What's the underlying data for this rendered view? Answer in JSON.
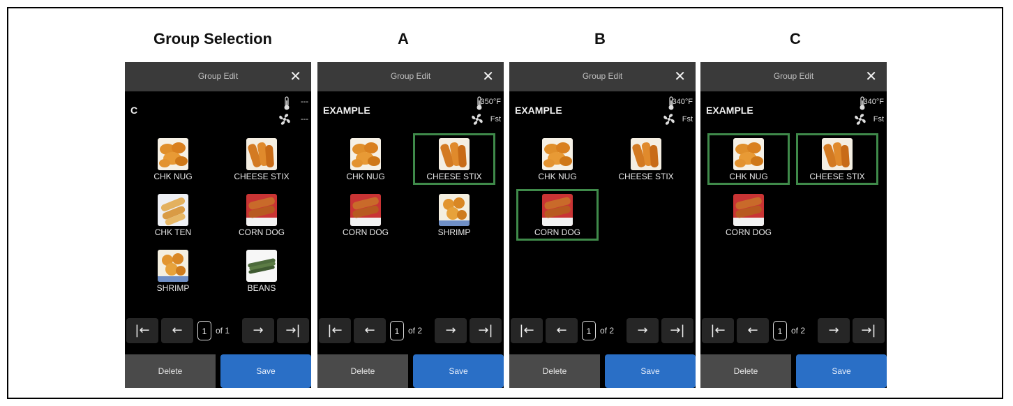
{
  "titles": {
    "group_selection": "Group Selection",
    "a": "A",
    "b": "B",
    "c": "C"
  },
  "screens": [
    {
      "header_title": "Group Edit",
      "close_glyph": "✕",
      "group_name": "C",
      "temp": "---",
      "fan": "---",
      "items": [
        {
          "label": "CHK NUG",
          "icon": "chicken-nuggets-image",
          "selected": false
        },
        {
          "label": "CHEESE STIX",
          "icon": "cheese-sticks-image",
          "selected": false
        },
        {
          "label": "CHK TEN",
          "icon": "chicken-tenders-image",
          "selected": false
        },
        {
          "label": "CORN DOG",
          "icon": "corn-dog-image",
          "selected": false
        },
        {
          "label": "SHRIMP",
          "icon": "shrimp-image",
          "selected": false
        },
        {
          "label": "BEANS",
          "icon": "beans-image",
          "selected": false
        }
      ],
      "pager": {
        "first": "|←",
        "prev": "←",
        "page": "1",
        "of": "of 1",
        "next": "→",
        "last": "→|"
      },
      "delete_label": "Delete",
      "save_label": "Save"
    },
    {
      "header_title": "Group Edit",
      "close_glyph": "✕",
      "group_name": "EXAMPLE",
      "temp": "350°F",
      "fan": "Fst",
      "items": [
        {
          "label": "CHK NUG",
          "icon": "chicken-nuggets-image",
          "selected": false
        },
        {
          "label": "CHEESE STIX",
          "icon": "cheese-sticks-image",
          "selected": true
        },
        {
          "label": "CORN DOG",
          "icon": "corn-dog-image",
          "selected": false
        },
        {
          "label": "SHRIMP",
          "icon": "shrimp-image",
          "selected": false
        }
      ],
      "pager": {
        "first": "|←",
        "prev": "←",
        "page": "1",
        "of": "of 2",
        "next": "→",
        "last": "→|"
      },
      "delete_label": "Delete",
      "save_label": "Save"
    },
    {
      "header_title": "Group Edit",
      "close_glyph": "✕",
      "group_name": "EXAMPLE",
      "temp": "340°F",
      "fan": "Fst",
      "items": [
        {
          "label": "CHK NUG",
          "icon": "chicken-nuggets-image",
          "selected": false
        },
        {
          "label": "CHEESE STIX",
          "icon": "cheese-sticks-image",
          "selected": false
        },
        {
          "label": "CORN DOG",
          "icon": "corn-dog-image",
          "selected": true
        }
      ],
      "pager": {
        "first": "|←",
        "prev": "←",
        "page": "1",
        "of": "of 2",
        "next": "→",
        "last": "→|"
      },
      "delete_label": "Delete",
      "save_label": "Save"
    },
    {
      "header_title": "Group Edit",
      "close_glyph": "✕",
      "group_name": "EXAMPLE",
      "temp": "340°F",
      "fan": "Fst",
      "items": [
        {
          "label": "CHK NUG",
          "icon": "chicken-nuggets-image",
          "selected": true
        },
        {
          "label": "CHEESE STIX",
          "icon": "cheese-sticks-image",
          "selected": true
        },
        {
          "label": "CORN DOG",
          "icon": "corn-dog-image",
          "selected": false
        }
      ],
      "pager": {
        "first": "|←",
        "prev": "←",
        "page": "1",
        "of": "of 2",
        "next": "→",
        "last": "→|"
      },
      "delete_label": "Delete",
      "save_label": "Save"
    }
  ],
  "colors": {
    "selection_border": "#3f8a4a",
    "save_button": "#2a6fc6",
    "header_bar": "#3a3a3a"
  }
}
